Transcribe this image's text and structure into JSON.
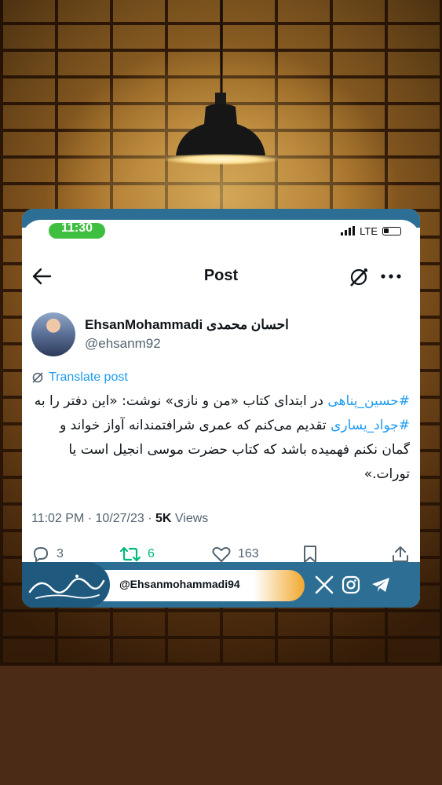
{
  "status_bar": {
    "time": "11:30",
    "network": "LTE"
  },
  "nav": {
    "title": "Post"
  },
  "author": {
    "name": "EhsanMohammadi احسان محمدی",
    "handle": "@ehsanm92"
  },
  "translate_label": "Translate post",
  "tweet": {
    "hashtag1": "#حسین_پناهی",
    "part1": " در ابتدای کتاب «من و نازی» نوشت: «این دفتر را به ",
    "hashtag2": "#جواد_یساری",
    "part2": " تقدیم می‌کنم که عمری شرافتمندانه آواز خواند و گمان نکنم فهمیده باشد که کتاب حضرت موسی انجیل است یا تورات.»"
  },
  "meta": {
    "time_date": "11:02 PM · 10/27/23 · ",
    "views_count": "5K",
    "views_label": " Views"
  },
  "actions": {
    "replies": "3",
    "reposts": "6",
    "likes": "163"
  },
  "banner": {
    "handle": "@Ehsanmohammadi94",
    "logo_text": "احسان محمدی"
  },
  "colors": {
    "brand_blue": "#2d6f94",
    "link_blue": "#1d9bf0",
    "repost_green": "#00ba7c",
    "accent_orange": "#f1a82e"
  },
  "icons": [
    "back-arrow-icon",
    "grok-icon",
    "more-icon",
    "translate-icon",
    "reply-icon",
    "repost-icon",
    "like-icon",
    "bookmark-icon",
    "share-icon",
    "x-logo-icon",
    "instagram-icon",
    "telegram-icon"
  ]
}
